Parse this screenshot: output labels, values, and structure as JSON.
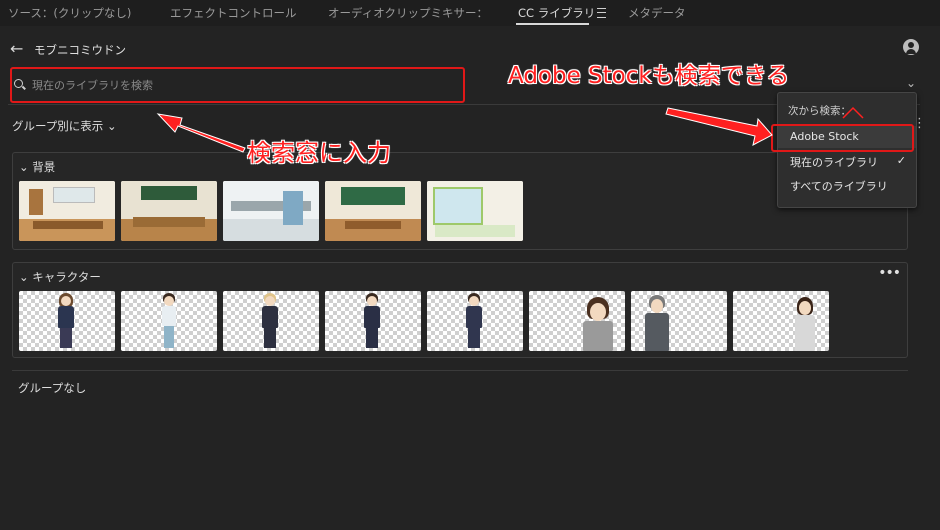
{
  "tabs": [
    {
      "label": "ソース：(クリップなし)"
    },
    {
      "label": "エフェクトコントロール"
    },
    {
      "label": "オーディオクリップミキサー："
    },
    {
      "label": "CC ライブラリ"
    },
    {
      "label": "メタデータ"
    }
  ],
  "active_tab": "CC ライブラリ",
  "library": {
    "title": "モブニコミウドン"
  },
  "search": {
    "placeholder": "現在のライブラリを検索"
  },
  "view": {
    "group_by_label": "グループ別に表示"
  },
  "groups": [
    {
      "name": "背景",
      "asset_count": 5
    },
    {
      "name": "キャラクター",
      "asset_count": 8
    }
  ],
  "ungrouped": {
    "label": "グループなし"
  },
  "search_scope_menu": {
    "heading": "次から検索：",
    "items": [
      {
        "label": "Adobe Stock"
      },
      {
        "label": "現在のライブラリ",
        "checked": true
      },
      {
        "label": "すべてのライブラリ"
      }
    ]
  },
  "annotations": {
    "stock": "Adobe Stockも検索できる",
    "search": "検索窓に入力"
  },
  "colors": {
    "annotation": "#ff2020",
    "highlight_box": "#e01818",
    "panel_bg": "#232323"
  }
}
